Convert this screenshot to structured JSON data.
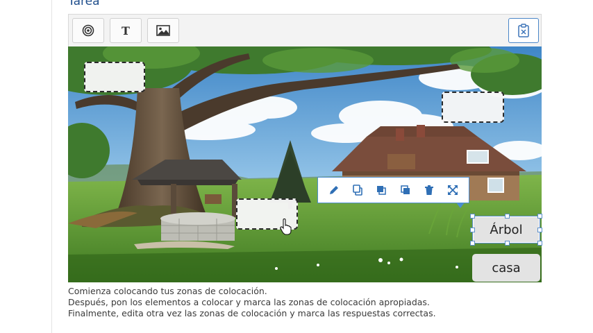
{
  "task": {
    "title": "Tarea"
  },
  "toolbar": {
    "drop_zone_tool": "drop-zone-icon",
    "text_tool": {
      "icon": "text-icon",
      "label": "T"
    },
    "image_tool": "image-icon",
    "paste_tool": "clipboard-paste-icon"
  },
  "canvas": {
    "background": "Landscape with large tree, stone well, pine tree and wooden house",
    "context_toolbar": [
      "pencil-icon",
      "copy-icon",
      "bring-to-front-icon",
      "send-to-back-icon",
      "trash-icon",
      "expand-icon"
    ],
    "draggables": [
      {
        "label": "Árbol",
        "selected": true
      },
      {
        "label": "casa",
        "selected": false
      }
    ]
  },
  "instructions": [
    "Comienza colocando tus zonas de colocación.",
    "Después, pon los elementos a colocar y marca las zonas de colocación apropiadas.",
    "Finalmente, edita otra vez las zonas de colocación y marca las respuestas correctas."
  ],
  "colors": {
    "accent": "#4b8ed0",
    "title": "#1f4e8c"
  }
}
